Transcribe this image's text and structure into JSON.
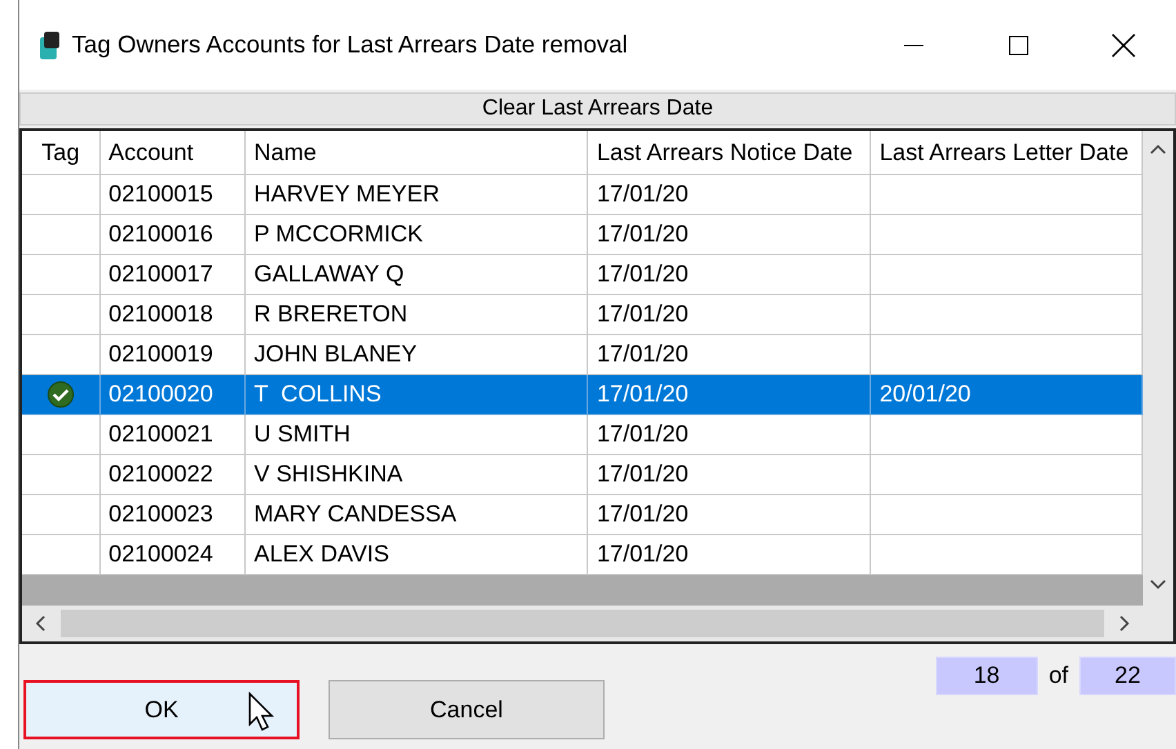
{
  "window": {
    "title": "Tag Owners Accounts for Last Arrears Date removal"
  },
  "caption": "Clear Last Arrears Date",
  "table": {
    "columns": [
      "Tag",
      "Account",
      "Name",
      "Last Arrears Notice Date",
      "Last Arrears Letter Date"
    ],
    "rows": [
      {
        "tagged": false,
        "selected": false,
        "account": "02100015",
        "name": "HARVEY MEYER",
        "notice": "17/01/20",
        "letter": ""
      },
      {
        "tagged": false,
        "selected": false,
        "account": "02100016",
        "name": "P MCCORMICK",
        "notice": "17/01/20",
        "letter": ""
      },
      {
        "tagged": false,
        "selected": false,
        "account": "02100017",
        "name": "GALLAWAY Q",
        "notice": "17/01/20",
        "letter": ""
      },
      {
        "tagged": false,
        "selected": false,
        "account": "02100018",
        "name": "R BRERETON",
        "notice": "17/01/20",
        "letter": ""
      },
      {
        "tagged": false,
        "selected": false,
        "account": "02100019",
        "name": "JOHN BLANEY",
        "notice": "17/01/20",
        "letter": ""
      },
      {
        "tagged": true,
        "selected": true,
        "account": "02100020",
        "name": "T  COLLINS",
        "notice": "17/01/20",
        "letter": "20/01/20"
      },
      {
        "tagged": false,
        "selected": false,
        "account": "02100021",
        "name": "U SMITH",
        "notice": "17/01/20",
        "letter": ""
      },
      {
        "tagged": false,
        "selected": false,
        "account": "02100022",
        "name": "V SHISHKINA",
        "notice": "17/01/20",
        "letter": ""
      },
      {
        "tagged": false,
        "selected": false,
        "account": "02100023",
        "name": "MARY CANDESSA",
        "notice": "17/01/20",
        "letter": ""
      },
      {
        "tagged": false,
        "selected": false,
        "account": "02100024",
        "name": "ALEX DAVIS",
        "notice": "17/01/20",
        "letter": ""
      }
    ]
  },
  "counter": {
    "current": "18",
    "of": "of",
    "total": "22"
  },
  "buttons": [
    {
      "label": "OK",
      "focused": true
    },
    {
      "label": "Cancel",
      "focused": false
    }
  ]
}
